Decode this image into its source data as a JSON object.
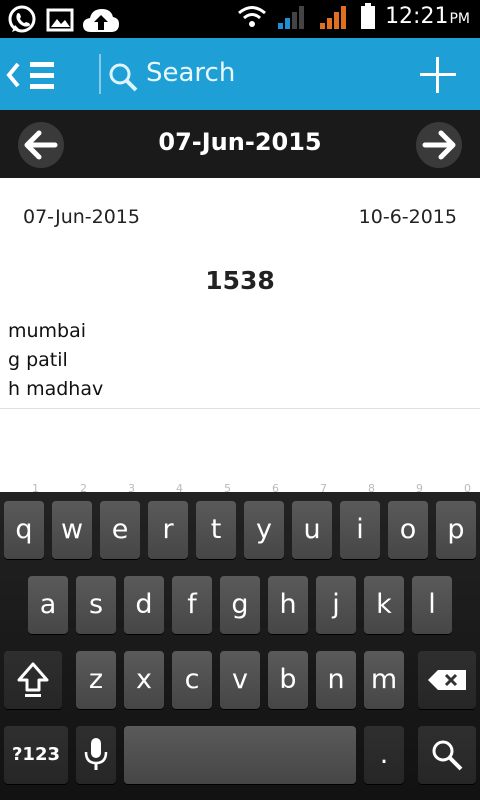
{
  "status_bar": {
    "time": "12:21",
    "ampm": "PM",
    "icons": [
      "whatsapp-icon",
      "gallery-icon",
      "cloud-upload-icon",
      "wifi-icon",
      "signal-icon",
      "signal-icon",
      "battery-icon"
    ]
  },
  "action_bar": {
    "search_label": "Search",
    "accent_color": "#1ea0d6"
  },
  "date_nav": {
    "title": "07-Jun-2015"
  },
  "entry": {
    "date_left": "07-Jun-2015",
    "date_right": "10-6-2015",
    "number": "1538",
    "lines": [
      "mumbai",
      "g patil",
      "h madhav"
    ]
  },
  "keyboard": {
    "row1": [
      {
        "label": "q",
        "hint": "1"
      },
      {
        "label": "w",
        "hint": "2"
      },
      {
        "label": "e",
        "hint": "3"
      },
      {
        "label": "r",
        "hint": "4"
      },
      {
        "label": "t",
        "hint": "5"
      },
      {
        "label": "y",
        "hint": "6"
      },
      {
        "label": "u",
        "hint": "7"
      },
      {
        "label": "i",
        "hint": "8"
      },
      {
        "label": "o",
        "hint": "9"
      },
      {
        "label": "p",
        "hint": "0"
      }
    ],
    "row2": [
      "a",
      "s",
      "d",
      "f",
      "g",
      "h",
      "j",
      "k",
      "l"
    ],
    "row3": [
      "z",
      "x",
      "c",
      "v",
      "b",
      "n",
      "m"
    ],
    "symbols_label": "?123",
    "period_label": "."
  }
}
